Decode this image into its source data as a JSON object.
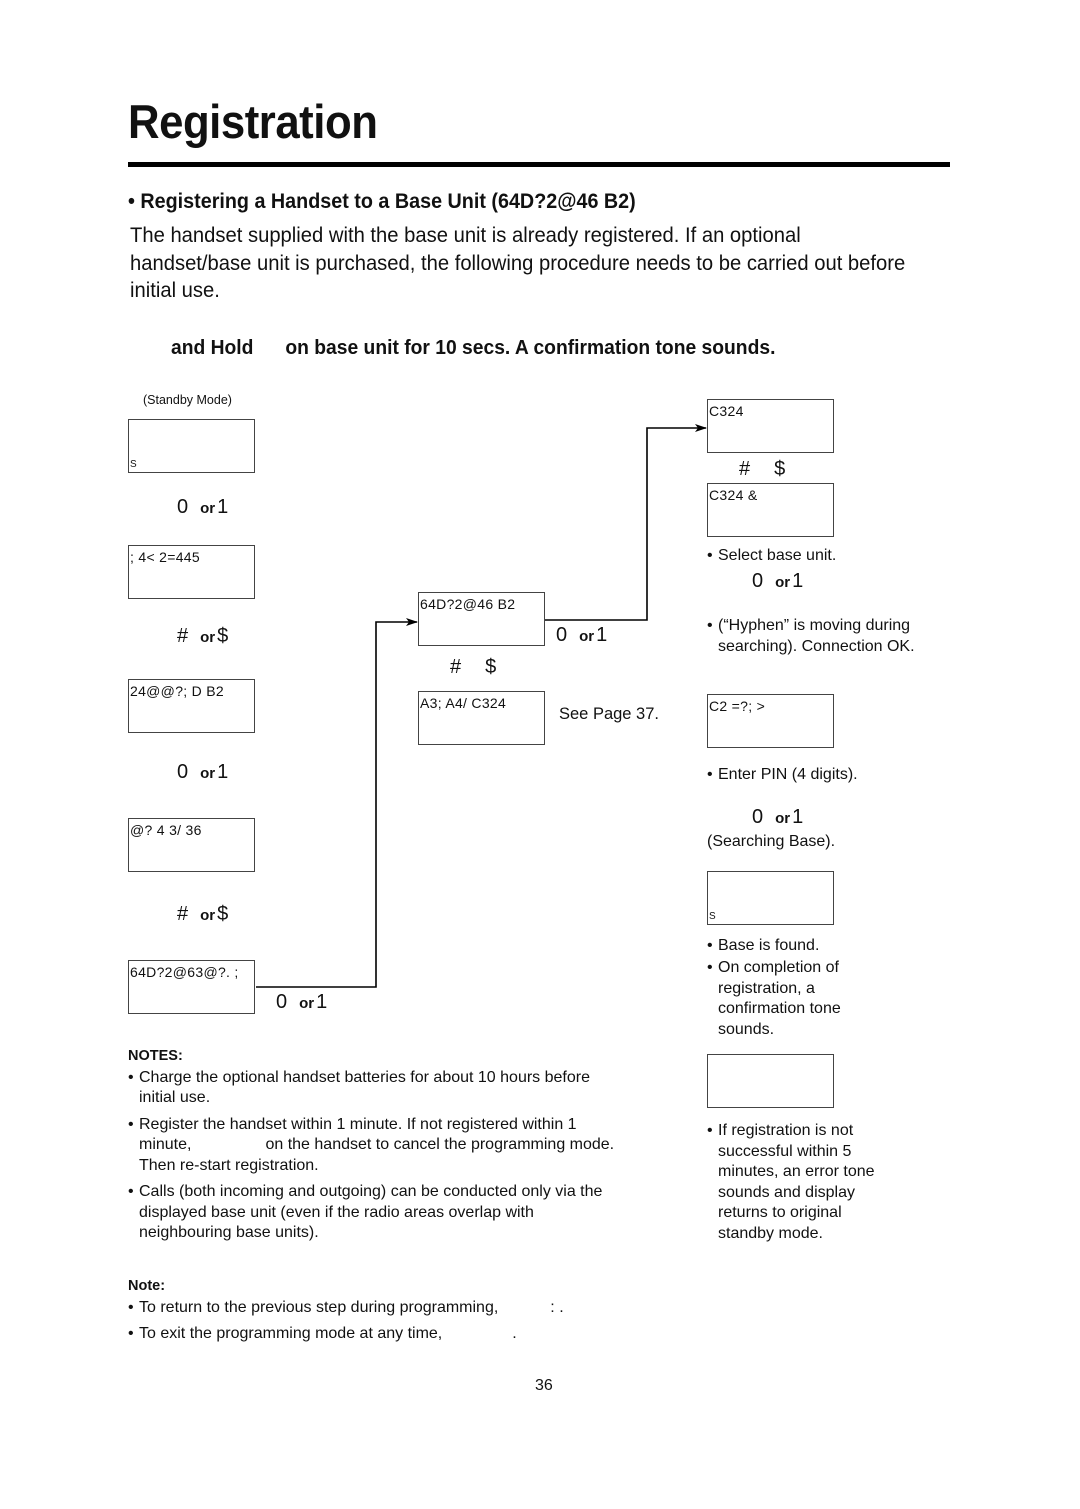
{
  "page": {
    "title": "Registration",
    "page_number": "36"
  },
  "section": {
    "heading": "• Registering a Handset to a Base Unit (64D?2@46  B2)",
    "intro": "The handset supplied with the base unit is already registered. If an optional handset/base unit is purchased, the following procedure needs to be carried out before initial use.",
    "step_instruction_part1": "and Hold",
    "step_instruction_part2": "on base unit for 10 secs. A confirmation tone sounds."
  },
  "flow": {
    "left_column": {
      "standby_caption": "(Standby Mode)",
      "lcd1": {
        "line1": "",
        "line2": "S"
      },
      "keys1": {
        "key_a": "0",
        "or": "or",
        "key_b": "1"
      },
      "lcd2": {
        "line1": "; 4< 2=445",
        "line2": ""
      },
      "keys2": {
        "key_a": "#",
        "or": "or",
        "key_b": "$"
      },
      "lcd3": {
        "line1": "24@@?; D B2",
        "line2": ""
      },
      "keys3": {
        "key_a": "0",
        "or": "or",
        "key_b": "1"
      },
      "lcd4": {
        "line1": "@?  4 3/ 36",
        "line2": ""
      },
      "keys4": {
        "key_a": "#",
        "or": "or",
        "key_b": "$"
      },
      "lcd5": {
        "line1": "64D?2@63@?. ;",
        "line2": ""
      },
      "keys5": {
        "key_a": "0",
        "or": "or",
        "key_b": "1"
      }
    },
    "middle_column": {
      "lcd1": {
        "line1": "64D?2@46  B2",
        "line2": ""
      },
      "keys1": {
        "key_a": "0",
        "or": "or",
        "key_b": "1"
      },
      "scroll_keys": {
        "key_a": "#",
        "key_b": "$"
      },
      "lcd2": {
        "line1": "A3; A4/  C324",
        "line2": ""
      },
      "see_page": "See Page 37."
    },
    "right_column": {
      "lcd1": {
        "line1": "C324",
        "line2": ""
      },
      "scroll_keys": {
        "key_a": "#",
        "key_b": "$"
      },
      "lcd2": {
        "line1": "C324 &",
        "line2": ""
      },
      "note_select": "Select base unit.",
      "keys1": {
        "key_a": "0",
        "or": "or",
        "key_b": "1"
      },
      "note_hyphen": "(“Hyphen” is moving during searching). Connection OK.",
      "lcd3": {
        "line1": "C2  =?;   >",
        "line2": ""
      },
      "note_pin": "Enter PIN (4 digits).",
      "keys2": {
        "key_a": "0",
        "or": "or",
        "key_b": "1"
      },
      "searching_caption": "(Searching Base).",
      "lcd4": {
        "line1": "",
        "line2": "S"
      },
      "note_found": "Base is found.",
      "note_completion": "On completion of registration, a confirmation tone sounds.",
      "lcd5": {
        "line1": "",
        "line2": ""
      },
      "note_error": "If registration is not successful within 5 minutes, an error tone sounds and display returns to original standby mode."
    }
  },
  "notes": {
    "heading": "NOTES:",
    "items": [
      "Charge the optional handset batteries for about 10 hours before initial use.",
      {
        "before": "Register the handset within 1 minute. If not registered within 1 minute,",
        "after": "on the handset to cancel the programming mode. Then re-start registration."
      },
      "Calls (both incoming and outgoing) can be conducted only via the displayed base unit (even if the radio areas overlap with neighbouring base units)."
    ]
  },
  "note": {
    "heading": "Note:",
    "items": [
      {
        "before": "To return to the previous step during programming,",
        "after": ":  ."
      },
      {
        "before": "To exit the programming mode at any time,",
        "after": "."
      }
    ]
  },
  "bullet": "•"
}
